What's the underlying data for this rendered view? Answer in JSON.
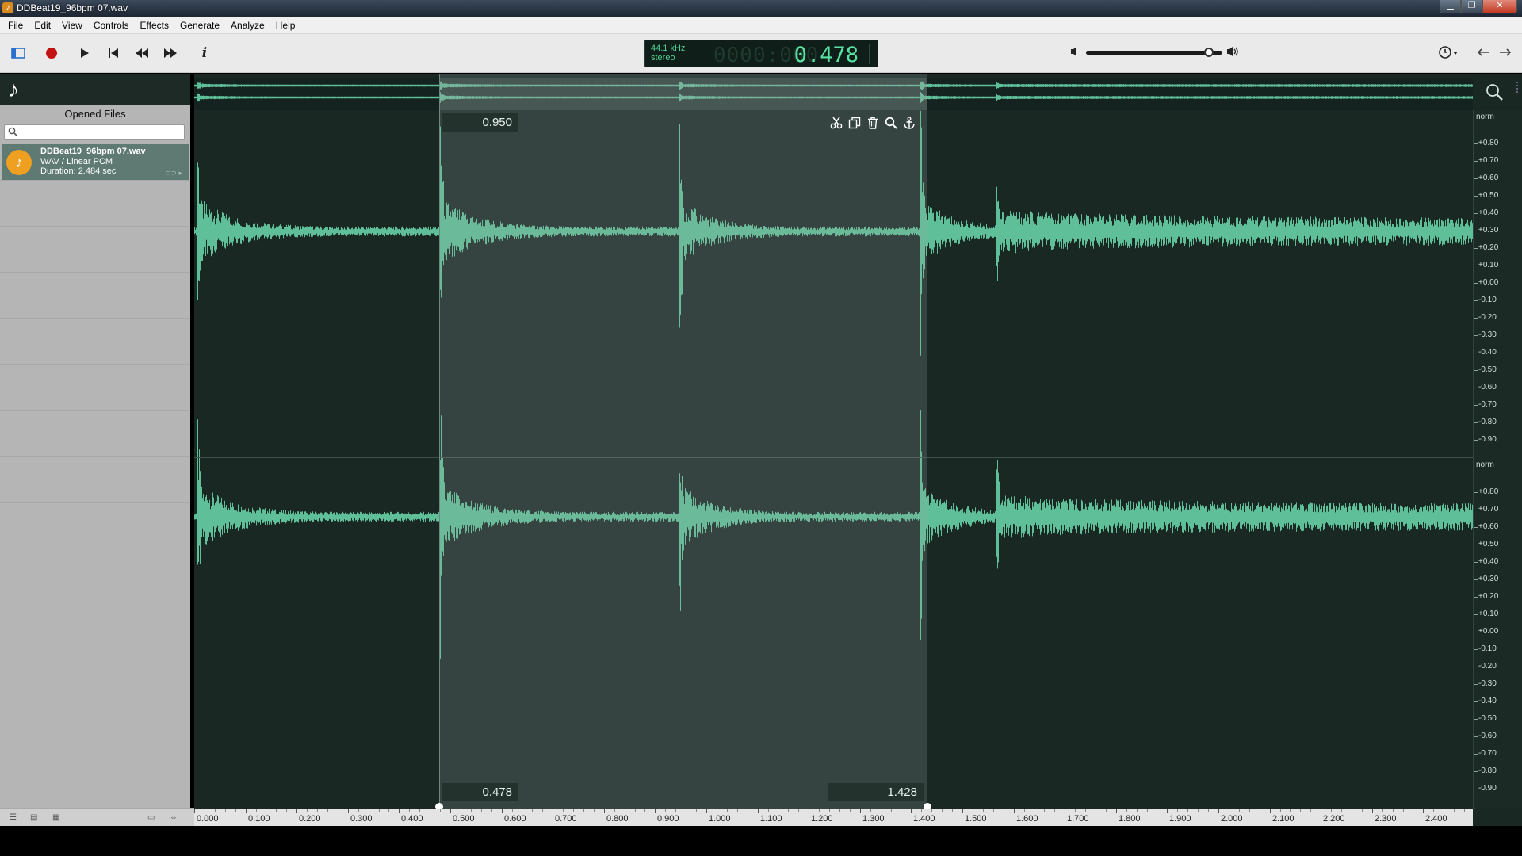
{
  "window": {
    "title": "DDBeat19_96bpm 07.wav"
  },
  "menu": [
    "File",
    "Edit",
    "View",
    "Controls",
    "Effects",
    "Generate",
    "Analyze",
    "Help"
  ],
  "toolbar": {
    "sample_rate": "44.1 kHz",
    "channels": "stereo",
    "ghost_digits": "0000:000",
    "position": "0.478",
    "volume_level": 0.9,
    "info_label": "i"
  },
  "sidebar": {
    "title": "Opened Files",
    "search_placeholder": "",
    "files": [
      {
        "name": "DDBeat19_96bpm 07.wav",
        "format": "WAV / Linear PCM",
        "duration": "Duration: 2.484 sec"
      }
    ]
  },
  "selection": {
    "start": "0.478",
    "end": "1.428",
    "length": "0.950"
  },
  "amplitude_scale": {
    "channel1_label": "norm",
    "channel2_label": "norm",
    "ticks": [
      "+0.80",
      "+0.70",
      "+0.60",
      "+0.50",
      "+0.40",
      "+0.30",
      "+0.20",
      "+0.10",
      "+0.00",
      "-0.10",
      "-0.20",
      "-0.30",
      "-0.40",
      "-0.50",
      "-0.60",
      "-0.70",
      "-0.80",
      "-0.90"
    ]
  },
  "time_ruler": {
    "labels": [
      "0.000",
      "0.100",
      "0.200",
      "0.300",
      "0.400",
      "0.500",
      "0.600",
      "0.700",
      "0.800",
      "0.900",
      "1.000",
      "1.100",
      "1.200",
      "1.300",
      "1.400",
      "1.500",
      "1.600",
      "1.700",
      "1.800",
      "1.900",
      "2.000",
      "2.100",
      "2.200",
      "2.300",
      "2.400"
    ]
  },
  "colors": {
    "waveform": "#5fbf98",
    "background": "#1a2824",
    "selection": "#95aaa5",
    "lcd_text": "#58e3a4"
  },
  "icons": {
    "toggle_panel": "panel-icon",
    "record": "record-icon",
    "play": "play-icon",
    "skip_start": "skip-start-icon",
    "rewind": "rewind-icon",
    "fast_forward": "fast-forward-icon",
    "info": "info-icon",
    "history": "history-icon",
    "undo": "arrow-left-icon",
    "redo": "arrow-right-icon",
    "cut": "scissors-icon",
    "copy": "copy-icon",
    "delete": "trash-icon",
    "zoom": "magnifier-icon",
    "anchor": "anchor-icon"
  }
}
